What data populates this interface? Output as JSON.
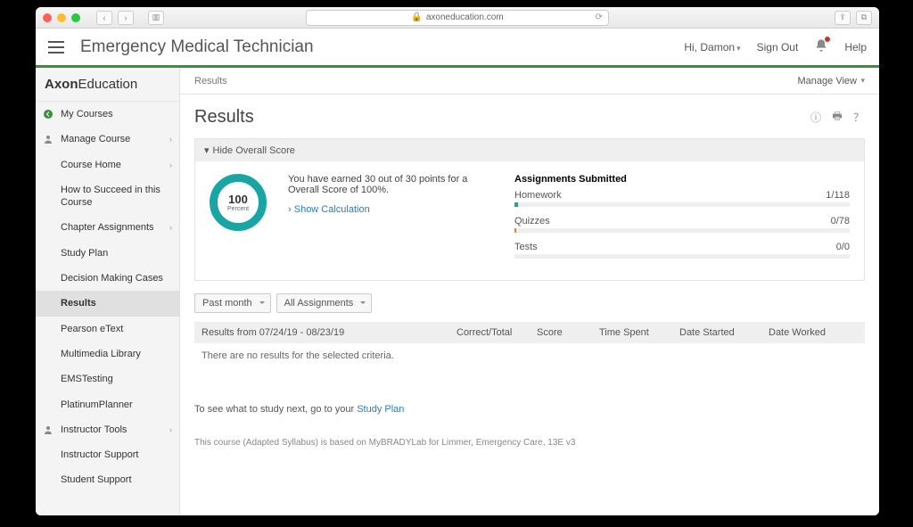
{
  "browser": {
    "url": "axoneducation.com"
  },
  "header": {
    "course_title": "Emergency Medical Technician",
    "greeting": "Hi, Damon",
    "sign_out": "Sign Out",
    "help": "Help"
  },
  "brand": {
    "bold": "Axon",
    "rest": "Education"
  },
  "sidebar": [
    {
      "label": "My Courses",
      "icon": "back",
      "chev": false,
      "indent": false,
      "active": false
    },
    {
      "label": "Manage Course",
      "icon": "user",
      "chev": true,
      "indent": false,
      "active": false
    },
    {
      "label": "Course Home",
      "icon": null,
      "chev": true,
      "indent": true,
      "active": false
    },
    {
      "label": "How to Succeed in this Course",
      "icon": null,
      "chev": false,
      "indent": true,
      "active": false
    },
    {
      "label": "Chapter Assignments",
      "icon": null,
      "chev": true,
      "indent": true,
      "active": false
    },
    {
      "label": "Study Plan",
      "icon": null,
      "chev": false,
      "indent": true,
      "active": false
    },
    {
      "label": "Decision Making Cases",
      "icon": null,
      "chev": false,
      "indent": true,
      "active": false
    },
    {
      "label": "Results",
      "icon": null,
      "chev": false,
      "indent": true,
      "active": true
    },
    {
      "label": "Pearson eText",
      "icon": null,
      "chev": false,
      "indent": true,
      "active": false
    },
    {
      "label": "Multimedia Library",
      "icon": null,
      "chev": false,
      "indent": true,
      "active": false
    },
    {
      "label": "EMSTesting",
      "icon": null,
      "chev": false,
      "indent": true,
      "active": false
    },
    {
      "label": "PlatinumPlanner",
      "icon": null,
      "chev": false,
      "indent": true,
      "active": false
    },
    {
      "label": "Instructor Tools",
      "icon": "user",
      "chev": true,
      "indent": false,
      "active": false
    },
    {
      "label": "Instructor Support",
      "icon": null,
      "chev": false,
      "indent": true,
      "active": false
    },
    {
      "label": "Student Support",
      "icon": null,
      "chev": false,
      "indent": true,
      "active": false
    }
  ],
  "crumb": {
    "text": "Results",
    "manage_view": "Manage View"
  },
  "page": {
    "title": "Results",
    "hide_overall": "Hide Overall Score",
    "donut": {
      "value": "100",
      "label": "Percent"
    },
    "summary_text": "You have earned 30 out of 30 points for a Overall Score of 100%.",
    "show_calc": "Show Calculation",
    "assignments_title": "Assignments Submitted",
    "assignments": [
      {
        "name": "Homework",
        "value": "1/118",
        "fill_pct": 1,
        "color": "#1aa5a5"
      },
      {
        "name": "Quizzes",
        "value": "0/78",
        "fill_pct": 0.5,
        "color": "#d98c3a"
      },
      {
        "name": "Tests",
        "value": "0/0",
        "fill_pct": 0,
        "color": "#ccc"
      }
    ],
    "filter_time": "Past month",
    "filter_type": "All Assignments",
    "table": {
      "headers": [
        "Results from 07/24/19 - 08/23/19",
        "Correct/Total",
        "Score",
        "Time Spent",
        "Date Started",
        "Date Worked"
      ],
      "empty": "There are no results for the selected criteria."
    },
    "study_prompt_pre": "To see what to study next, go to your ",
    "study_prompt_link": "Study Plan",
    "footnote": "This course (Adapted Syllabus) is based on MyBRADYLab for Limmer, Emergency Care, 13E v3"
  }
}
